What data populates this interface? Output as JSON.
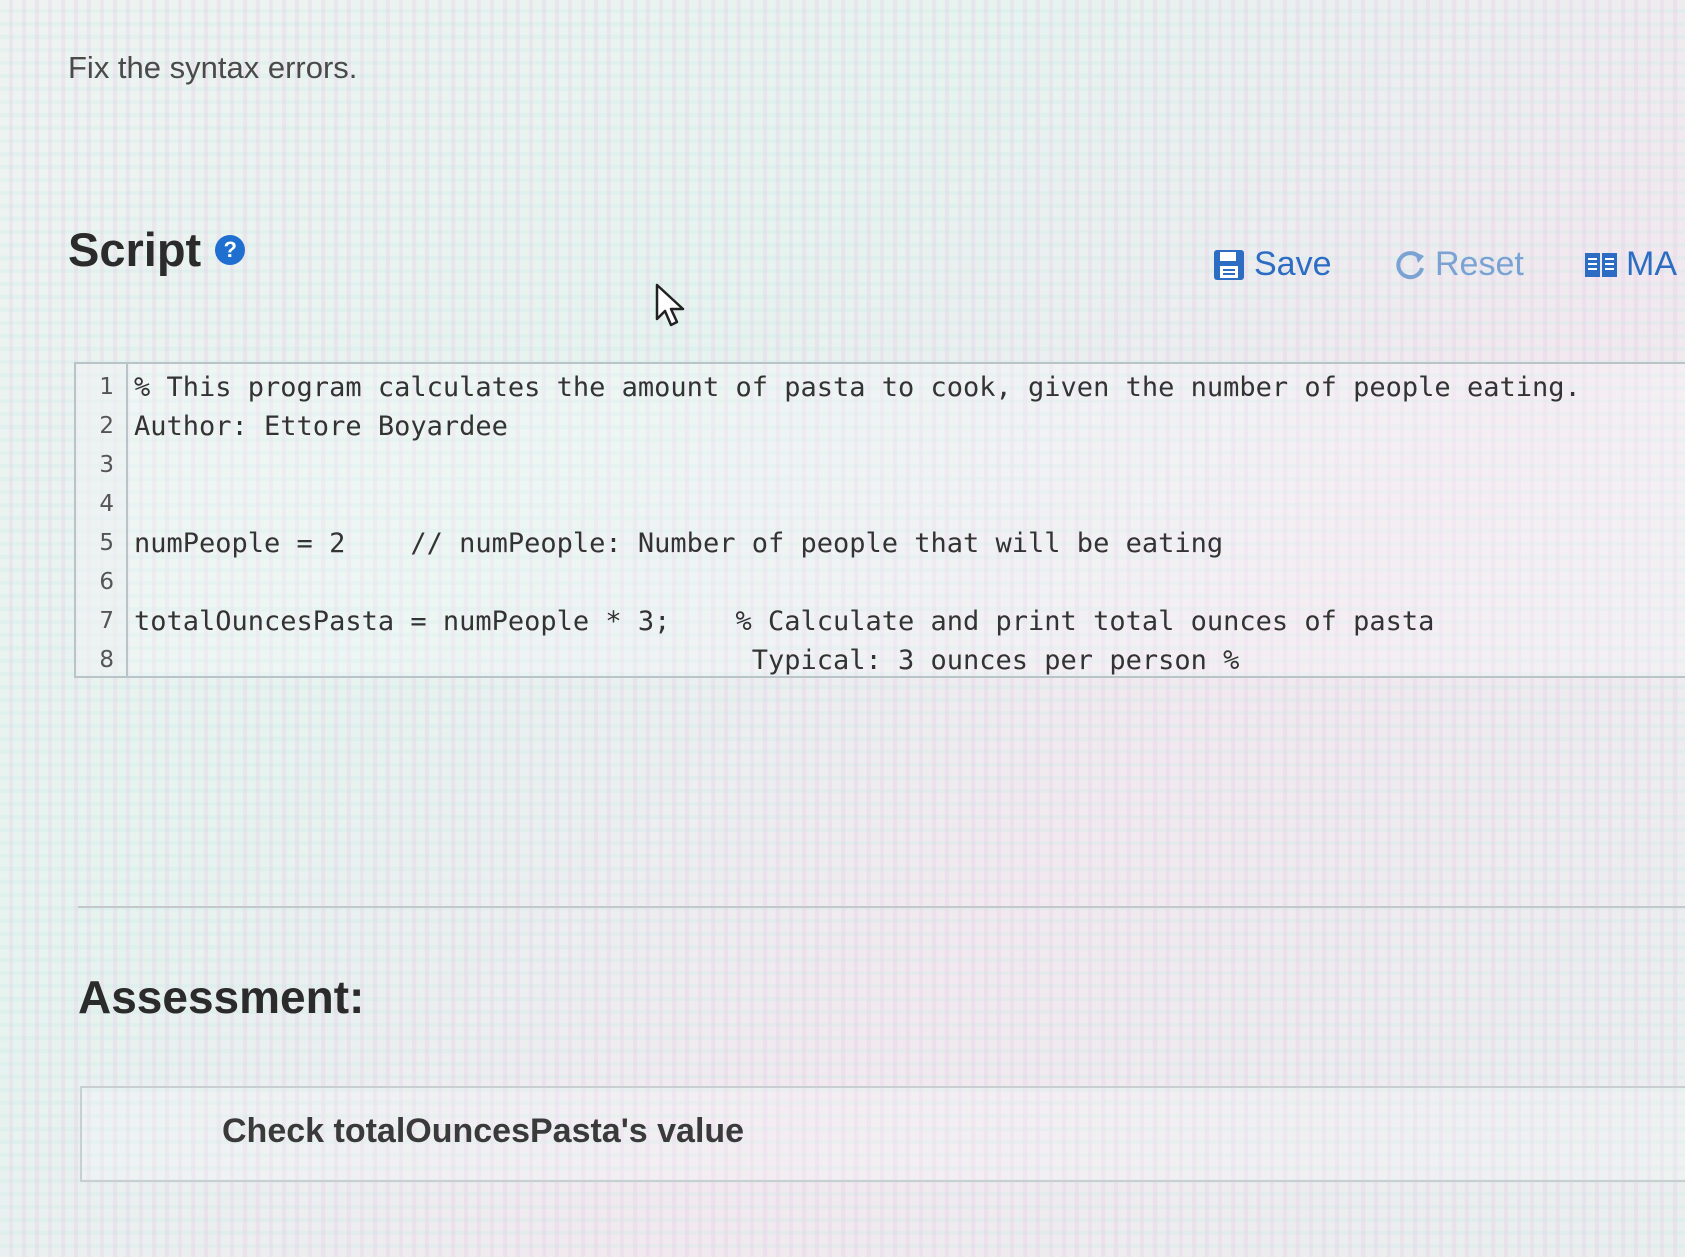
{
  "instructions": "Fix the syntax errors.",
  "script": {
    "title": "Script",
    "help_icon": "?"
  },
  "toolbar": {
    "save_label": "Save",
    "reset_label": "Reset",
    "mat_label": "MA"
  },
  "editor": {
    "line_numbers": [
      "1",
      "2",
      "3",
      "4",
      "5",
      "6",
      "7",
      "8"
    ],
    "lines": [
      "% This program calculates the amount of pasta to cook, given the number of people eating.",
      "Author: Ettore Boyardee",
      "",
      "",
      "numPeople = 2    // numPeople: Number of people that will be eating",
      "",
      "totalOuncesPasta = numPeople * 3;    % Calculate and print total ounces of pasta",
      "                                      Typical: 3 ounces per person %"
    ]
  },
  "assessment": {
    "title": "Assessment:",
    "check_label": "Check totalOuncesPasta's value"
  }
}
